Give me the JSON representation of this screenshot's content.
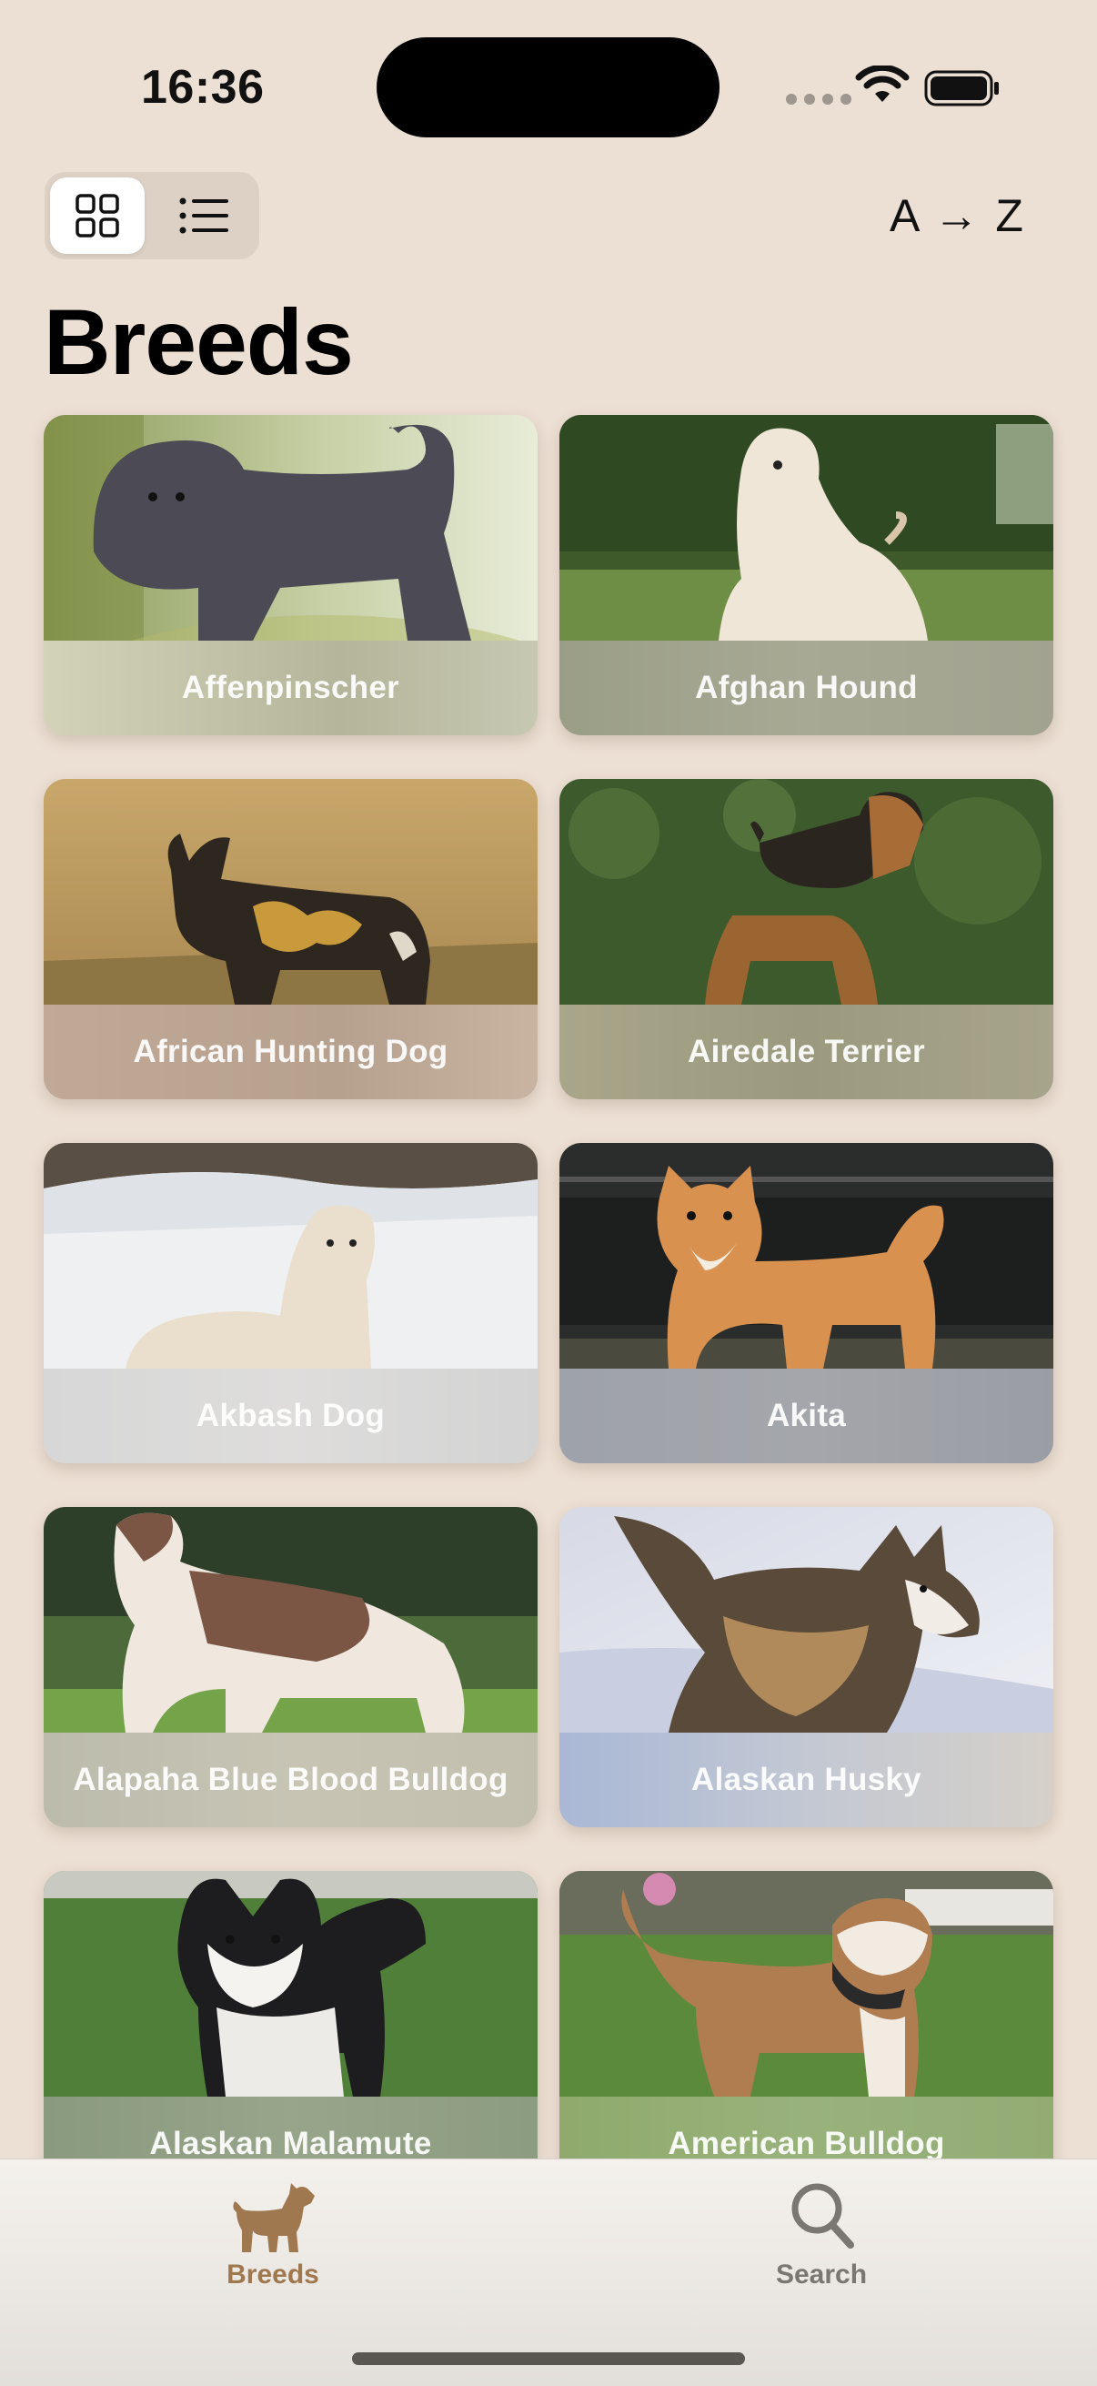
{
  "status_bar": {
    "time": "16:36"
  },
  "toolbar": {
    "grid_view_icon": "grid-icon",
    "list_view_icon": "list-icon",
    "active_view": "grid",
    "sort_label": "A → Z"
  },
  "page": {
    "title": "Breeds"
  },
  "breeds": [
    {
      "name": "Affenpinscher",
      "photo": "affenpinscher"
    },
    {
      "name": "Afghan Hound",
      "photo": "afghan-hound"
    },
    {
      "name": "African Hunting Dog",
      "photo": "african-hunting-dog"
    },
    {
      "name": "Airedale Terrier",
      "photo": "airedale-terrier"
    },
    {
      "name": "Akbash Dog",
      "photo": "akbash-dog"
    },
    {
      "name": "Akita",
      "photo": "akita"
    },
    {
      "name": "Alapaha Blue Blood Bulldog",
      "photo": "alapaha-bulldog"
    },
    {
      "name": "Alaskan Husky",
      "photo": "alaskan-husky"
    },
    {
      "name": "Alaskan Malamute",
      "photo": "alaskan-malamute"
    },
    {
      "name": "American Bulldog",
      "photo": "american-bulldog"
    }
  ],
  "tab_bar": {
    "tabs": [
      {
        "label": "Breeds",
        "icon": "dog-icon",
        "selected": true
      },
      {
        "label": "Search",
        "icon": "magnifier-icon",
        "selected": false
      }
    ]
  },
  "colors": {
    "background": "#ecdfd3",
    "accent": "#a0784f",
    "inactive_tab": "#7a7773"
  }
}
